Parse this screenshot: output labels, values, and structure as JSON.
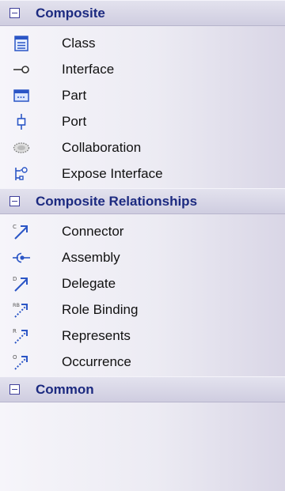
{
  "groups": [
    {
      "title": "Composite",
      "items": [
        {
          "label": "Class",
          "icon": "class-icon"
        },
        {
          "label": "Interface",
          "icon": "interface-icon"
        },
        {
          "label": "Part",
          "icon": "part-icon"
        },
        {
          "label": "Port",
          "icon": "port-icon"
        },
        {
          "label": "Collaboration",
          "icon": "collaboration-icon"
        },
        {
          "label": "Expose Interface",
          "icon": "expose-interface-icon"
        }
      ]
    },
    {
      "title": "Composite Relationships",
      "items": [
        {
          "label": "Connector",
          "icon": "connector-icon",
          "tag": "C"
        },
        {
          "label": "Assembly",
          "icon": "assembly-icon"
        },
        {
          "label": "Delegate",
          "icon": "delegate-icon",
          "tag": "D"
        },
        {
          "label": "Role Binding",
          "icon": "role-binding-icon",
          "tag": "RB"
        },
        {
          "label": "Represents",
          "icon": "represents-icon",
          "tag": "R"
        },
        {
          "label": "Occurrence",
          "icon": "occurrence-icon",
          "tag": "O"
        }
      ]
    },
    {
      "title": "Common",
      "items": []
    }
  ],
  "colors": {
    "header_text": "#1c2a80",
    "toggle_border": "#3f3f9a",
    "icon_blue": "#2b56c6"
  }
}
